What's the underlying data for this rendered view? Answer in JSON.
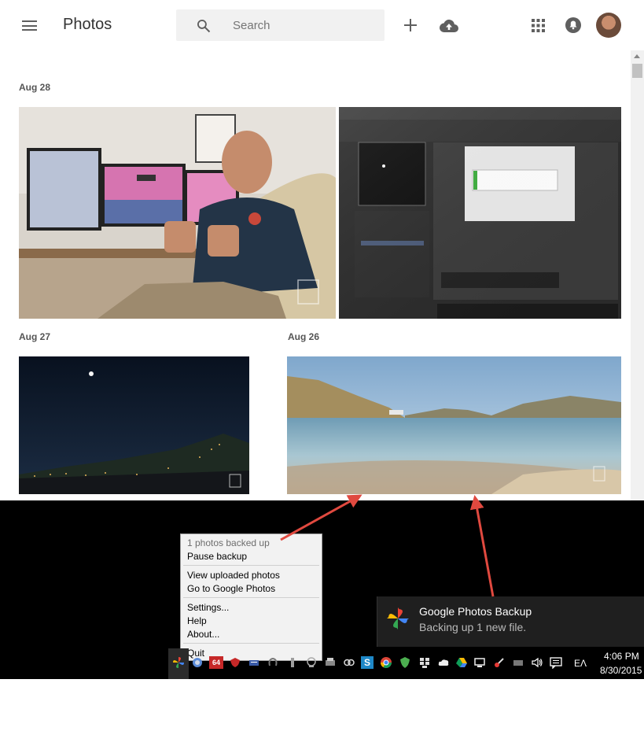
{
  "app": {
    "title": "Photos"
  },
  "search": {
    "placeholder": "Search",
    "value": ""
  },
  "sections": [
    {
      "date": "Aug 28"
    },
    {
      "date": "Aug 27"
    },
    {
      "date": "Aug 26"
    }
  ],
  "context_menu": {
    "status": "1 photos backed up",
    "items": [
      "Pause backup",
      "View uploaded photos",
      "Go to Google Photos",
      "Settings...",
      "Help",
      "About...",
      "Quit"
    ]
  },
  "toast": {
    "title": "Google Photos Backup",
    "body": "Backing up 1 new file."
  },
  "taskbar": {
    "language": "ΕΛ",
    "time": "4:06 PM",
    "date": "8/30/2015",
    "badge": "64"
  },
  "colors": {
    "annotation_arrow": "#e0493f",
    "taskbar": "#000000",
    "toast_bg": "#1f1f1f"
  }
}
